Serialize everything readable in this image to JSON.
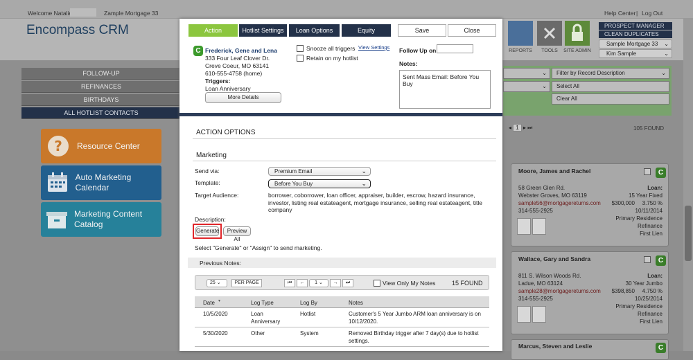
{
  "topbar": {
    "welcome": "Welcome Natalie",
    "company": "Zample Mortgage 33",
    "help": "Help Center",
    "separator": "|",
    "logout": "Log Out"
  },
  "app": {
    "title": "Encompass CRM"
  },
  "nav": {
    "items": [
      "FOLLOW-UP",
      "REFINANCES",
      "BIRTHDAYS",
      "ALL HOTLIST CONTACTS"
    ]
  },
  "tiles": [
    "Resource Center",
    "Auto Marketing Calendar",
    "Marketing Content Catalog"
  ],
  "tools": {
    "reports": "REPORTS",
    "tools": "TOOLS",
    "site_admin": "SITE ADMIN"
  },
  "right_nav": {
    "prospect": "PROSPECT MANAGER",
    "clean": "CLEAN DUPLICATES",
    "company_select": "Sample Mortgage 33",
    "user_select": "Kim Sample"
  },
  "filters": {
    "record_desc": "Filter by Record Description",
    "select_all": "Select All",
    "clear_all": "Clear All"
  },
  "results": {
    "found": "105 FOUND",
    "page": "1"
  },
  "cards": [
    {
      "name": "Moore, James and Rachel",
      "badge": "C",
      "addr1": "58 Green Glen Rd.",
      "addr2": "Webster Groves, MO 63119",
      "email": "sample56@mortgagereturns.com",
      "phone": "314-555-2925",
      "loan_label": "Loan:",
      "loan_type": "15 Year Fixed",
      "loan_amt": "$300,000",
      "loan_rate": "3.750 %",
      "loan_date": "10/11/2014",
      "residence": "Primary Residence",
      "purpose": "Refinance",
      "lien": "First Lien"
    },
    {
      "name": "Wallace, Gary and Sandra",
      "badge": "C",
      "addr1": "811 S. Wilson Woods Rd.",
      "addr2": "Ladue, MO 63124",
      "email": "sample28@mortgagereturns.com",
      "phone": "314-555-2925",
      "loan_label": "Loan:",
      "loan_type": "30 Year Jumbo",
      "loan_amt": "$398,850",
      "loan_rate": "4.750 %",
      "loan_date": "10/25/2014",
      "residence": "Primary Residence",
      "purpose": "Refinance",
      "lien": "First Lien"
    },
    {
      "name": "Marcus, Steven and Leslie",
      "badge": "C"
    }
  ],
  "modal": {
    "tabs": {
      "action": "Action",
      "hotlist": "Hotlist Settings",
      "loan": "Loan Options",
      "equity": "Equity"
    },
    "save": "Save",
    "close": "Close",
    "contact": {
      "badge": "C",
      "name": "Frederick, Gene and Lena",
      "addr1": "333 Four Leaf Clover Dr.",
      "addr2": "Creve Coeur, MO 63141",
      "phone": "610-555-4758 (home)",
      "triggers_label": "Triggers:",
      "trigger": "Loan Anniversary",
      "more_details": "More Details"
    },
    "snooze": "Snooze all triggers",
    "view_settings": "View Settings",
    "retain": "Retain on my hotlist",
    "follow_up_label": "Follow Up on:",
    "notes_label": "Notes:",
    "notes_value": "Sent Mass Email: Before You Buy",
    "action_options": "ACTION OPTIONS",
    "marketing": "Marketing",
    "send_via_label": "Send via:",
    "send_via_value": "Premium Email",
    "template_label": "Template:",
    "template_value": "Before You Buy",
    "audience_label": "Target Audience:",
    "audience_value": "borrower, coborrower, loan officer, appraiser, builder, escrow, hazard insurance, investor, listing real estateagent, mortgage insurance, selling real estateagent, title company",
    "description_label": "Description:",
    "generate": "Generate",
    "preview_all": "Preview All",
    "instruction": "Select \"Generate\" or \"Assign\" to send marketing.",
    "previous_notes": "Previous Notes:",
    "pager": {
      "per_page_value": "25",
      "per_page": "PER PAGE",
      "page": "1",
      "view_only": "View Only My Notes",
      "found": "15 FOUND"
    },
    "table": {
      "headers": [
        "Date",
        "Log Type",
        "Log By",
        "Notes"
      ],
      "rows": [
        {
          "date": "10/5/2020",
          "type": "Loan Anniversary",
          "by": "Hotlist",
          "notes": "Customer's 5 Year Jumbo ARM loan anniversary is on 10/12/2020."
        },
        {
          "date": "5/30/2020",
          "type": "Other",
          "by": "System",
          "notes": "Removed Birthday trigger after 7 day(s) due to hotlist settings."
        }
      ]
    }
  },
  "colors": {
    "green": "#8cc63f",
    "navy": "#233149",
    "orange": "#e0892a",
    "blue": "#2a77b5",
    "teal": "#2b95b0",
    "highlight": "#e0262a"
  }
}
